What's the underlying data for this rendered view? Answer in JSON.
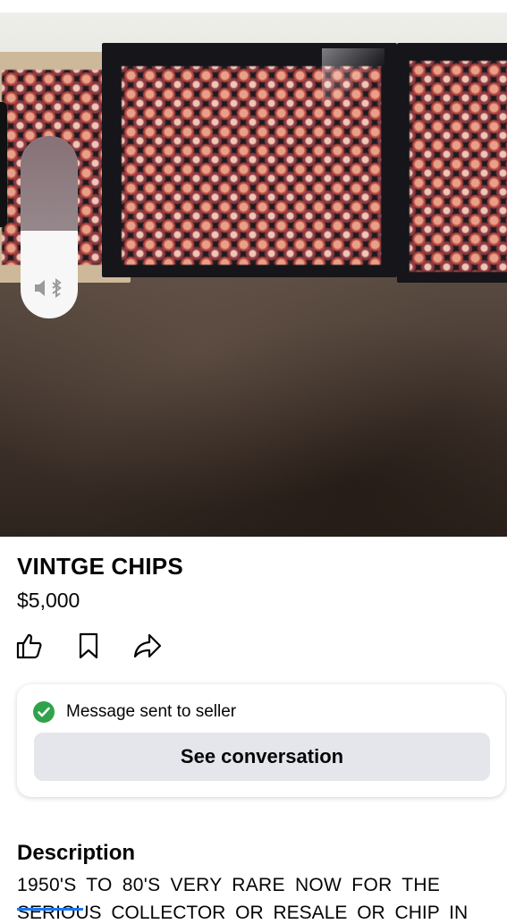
{
  "listing": {
    "title": "VINTGE CHIPS",
    "price": "$5,000"
  },
  "actions": {
    "icons": [
      "thumbs-up-icon",
      "bookmark-icon",
      "share-icon"
    ]
  },
  "notice": {
    "message": "Message sent to seller",
    "button_label": "See conversation",
    "status_color": "#31a24c"
  },
  "description": {
    "heading": "Description",
    "line1": "1950'S  TO 80'S  VERY  RARE  NOW  FOR THE",
    "line2": "SERIOUS  COLLECTOR  OR  RESALE OR CHIP IN"
  },
  "volume": {
    "icon": "speaker-muted-bluetooth-icon",
    "level": 0.48
  },
  "colors": {
    "button_bg": "#e4e6eb",
    "accent": "#1877f2"
  }
}
